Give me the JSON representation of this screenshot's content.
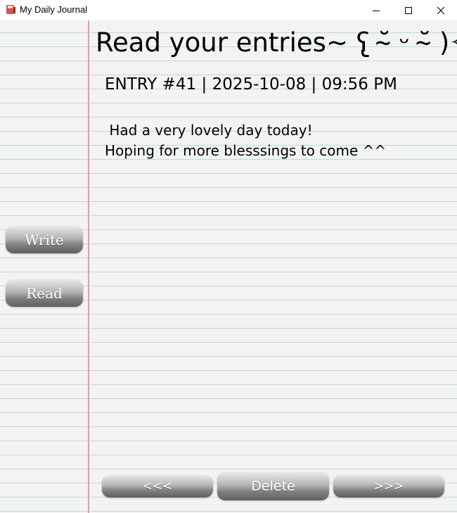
{
  "window": {
    "title": "My Daily Journal",
    "icon": "journal-app-icon",
    "controls": {
      "minimize": "minimize-icon",
      "maximize": "maximize-icon",
      "close": "close-icon"
    }
  },
  "page": {
    "title": "Read your entries~ ʕ̢ ˘̴ ᵕ ˘̴ )✧",
    "entry_header": "ENTRY #41 | 2025-10-08 | 09:56 PM",
    "entry_body": " Had a very lovely day today!\nHoping for more blesssings to come ^^"
  },
  "sidebar": {
    "write_label": "Write",
    "read_label": "Read"
  },
  "nav": {
    "prev_label": "<<<",
    "delete_label": "Delete",
    "next_label": ">>>"
  },
  "colors": {
    "paper": "#f3f3f3",
    "rule_line": "#bfd9dd",
    "margin_line": "#e6a0a6",
    "button_top": "#e9e9e9",
    "button_bottom": "#5f5f5f"
  }
}
